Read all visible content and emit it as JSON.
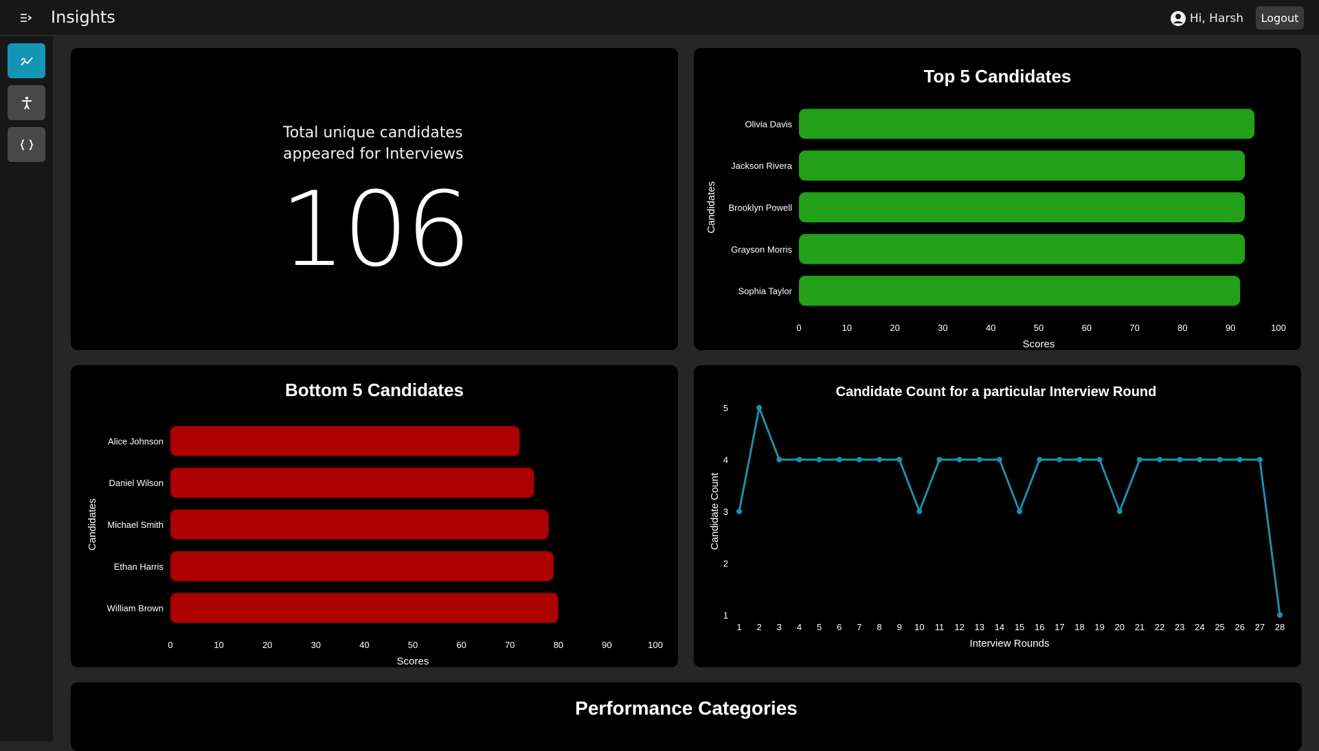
{
  "header": {
    "title": "Insights",
    "user_greeting": "Hi, Harsh",
    "logout_label": "Logout"
  },
  "sidebar": {
    "items": [
      {
        "name": "insights",
        "icon": "insights-chart-icon",
        "active": true
      },
      {
        "name": "accessibility",
        "icon": "accessibility-icon",
        "active": false
      },
      {
        "name": "code",
        "icon": "braces-icon",
        "active": false
      }
    ]
  },
  "stat": {
    "label_line1": "Total unique candidates",
    "label_line2": "appeared for Interviews",
    "value": "106"
  },
  "performance": {
    "title": "Performance Categories"
  },
  "colors": {
    "top_bars": "#22a01a",
    "bottom_bars": "#ad0000",
    "line": "#1e8eab",
    "accent": "#1595b5"
  },
  "chart_data": [
    {
      "type": "bar",
      "orientation": "horizontal",
      "title": "Top 5 Candidates",
      "xlabel": "Scores",
      "ylabel": "Candidates",
      "categories": [
        "Olivia Davis",
        "Jackson Rivera",
        "Brooklyn Powell",
        "Grayson Morris",
        "Sophia Taylor"
      ],
      "values": [
        95,
        93,
        93,
        93,
        92
      ],
      "xlim": [
        0,
        100
      ],
      "xticks": [
        0,
        10,
        20,
        30,
        40,
        50,
        60,
        70,
        80,
        90,
        100
      ]
    },
    {
      "type": "bar",
      "orientation": "horizontal",
      "title": "Bottom 5 Candidates",
      "xlabel": "Scores",
      "ylabel": "Candidates",
      "categories": [
        "Alice Johnson",
        "Daniel Wilson",
        "Michael Smith",
        "Ethan Harris",
        "William Brown"
      ],
      "values": [
        72,
        75,
        78,
        79,
        80
      ],
      "xlim": [
        0,
        100
      ],
      "xticks": [
        0,
        10,
        20,
        30,
        40,
        50,
        60,
        70,
        80,
        90,
        100
      ]
    },
    {
      "type": "line",
      "title": "Candidate Count for a particular Interview Round",
      "xlabel": "Interview Rounds",
      "ylabel": "Candidate Count",
      "x": [
        1,
        2,
        3,
        4,
        5,
        6,
        7,
        8,
        9,
        10,
        11,
        12,
        13,
        14,
        15,
        16,
        17,
        18,
        19,
        20,
        21,
        22,
        23,
        24,
        25,
        26,
        27,
        28
      ],
      "y": [
        3,
        5,
        4,
        4,
        4,
        4,
        4,
        4,
        4,
        3,
        4,
        4,
        4,
        4,
        3,
        4,
        4,
        4,
        4,
        3,
        4,
        4,
        4,
        4,
        4,
        4,
        4,
        1
      ],
      "ylim": [
        1,
        5
      ],
      "yticks": [
        1,
        2,
        3,
        4,
        5
      ]
    }
  ]
}
